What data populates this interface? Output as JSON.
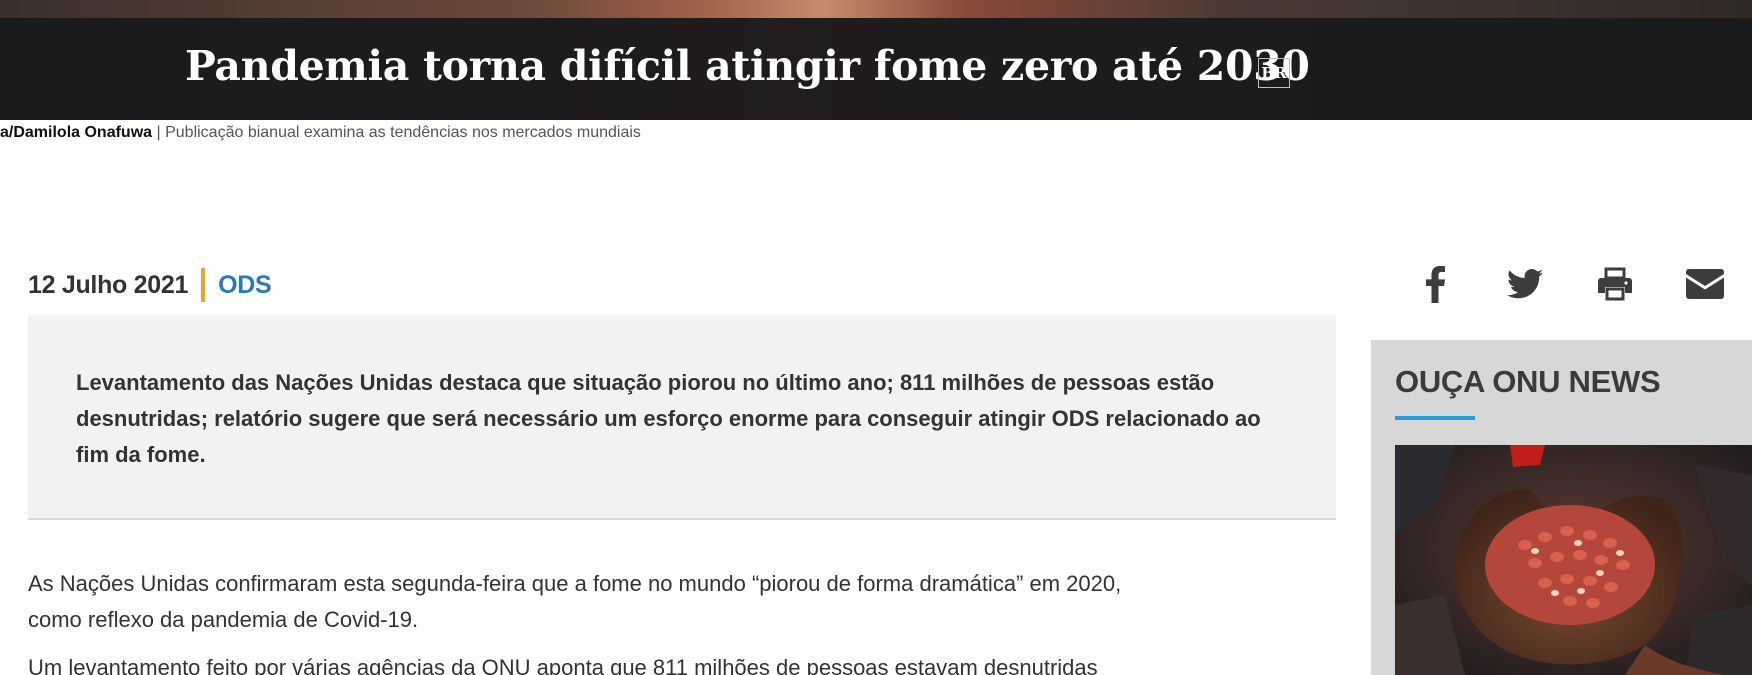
{
  "hero": {
    "title": "Pandemia torna difícil atingir fome zero até 2030",
    "language_badge": "BR"
  },
  "caption": {
    "credit": "a/Damilola Onafuwa",
    "separator": " | ",
    "text": "Publicação bianual examina as tendências nos mercados mundiais"
  },
  "meta": {
    "date": "12 Julho 2021",
    "tag": "ODS"
  },
  "share": {
    "icons": [
      "facebook-icon",
      "twitter-icon",
      "print-icon",
      "email-icon"
    ]
  },
  "lead": {
    "text": "Levantamento das Nações Unidas destaca que situação piorou no último ano; 811 milhões de pessoas estão desnutridas; relatório sugere que será necessário um esforço enorme para conseguir atingir ODS relacionado ao fim da fome."
  },
  "body": {
    "paragraphs": [
      "As Nações Unidas confirmaram esta segunda-feira que a fome no mundo “piorou de forma dramática” em 2020, como reflexo da pandemia de Covid-19.",
      "Um levantamento feito por várias agências da ONU aponta que 811 milhões de pessoas estavam desnutridas"
    ]
  },
  "sidebar": {
    "title": "OUÇA ONU NEWS"
  },
  "colors": {
    "accent_orange": "#f0a030",
    "link_blue": "#2a7ab8",
    "underline_blue": "#2a9bd8",
    "lead_bg": "#f2f2f2",
    "sidebar_bg": "#d7d7d7"
  }
}
